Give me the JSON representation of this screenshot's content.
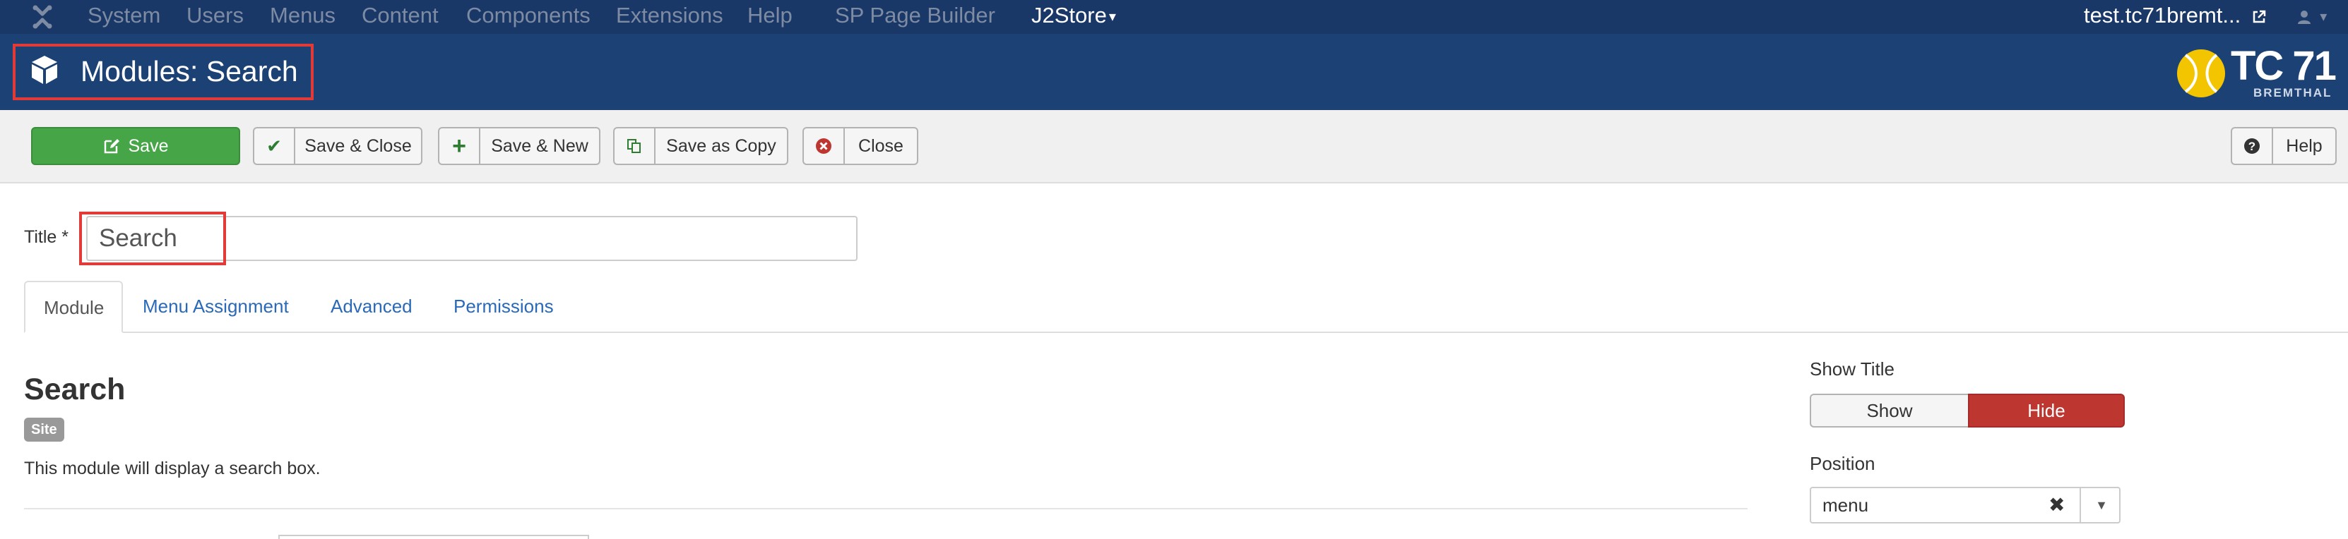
{
  "topnav": {
    "items": [
      "System",
      "Users",
      "Menus",
      "Content",
      "Components",
      "Extensions",
      "Help",
      "SP Page Builder",
      "J2Store"
    ],
    "caret": "▾",
    "site_link": "test.tc71bremt...",
    "site_link_icon": "external-link-icon",
    "user_icon": "user-icon"
  },
  "header": {
    "title": "Modules: Search",
    "icon": "cube-icon",
    "brand_logo_text": "TC 71",
    "brand_logo_subtext": "BREMTHAL"
  },
  "toolbar": {
    "save_label": "Save",
    "save_close_label": "Save & Close",
    "save_new_label": "Save & New",
    "save_copy_label": "Save as Copy",
    "close_label": "Close",
    "help_label": "Help"
  },
  "form": {
    "title_label": "Title",
    "required_marker": " *",
    "title_value": "Search"
  },
  "tabs": [
    {
      "label": "Module",
      "active": true
    },
    {
      "label": "Menu Assignment",
      "active": false
    },
    {
      "label": "Advanced",
      "active": false
    },
    {
      "label": "Permissions",
      "active": false
    }
  ],
  "main": {
    "heading": "Search",
    "badge": "Site",
    "description": "This module will display a search box."
  },
  "sidebar": {
    "show_title_label": "Show Title",
    "show_option": "Show",
    "hide_option": "Hide",
    "selected": "Hide",
    "position_label": "Position",
    "position_value": "menu"
  },
  "colors": {
    "topnav_bg": "#1a3867",
    "header_bg": "#1c4175",
    "save_green": "#46a546",
    "hide_red": "#bd362f",
    "highlight_red": "#e23a36",
    "link_blue": "#2a69b8"
  }
}
